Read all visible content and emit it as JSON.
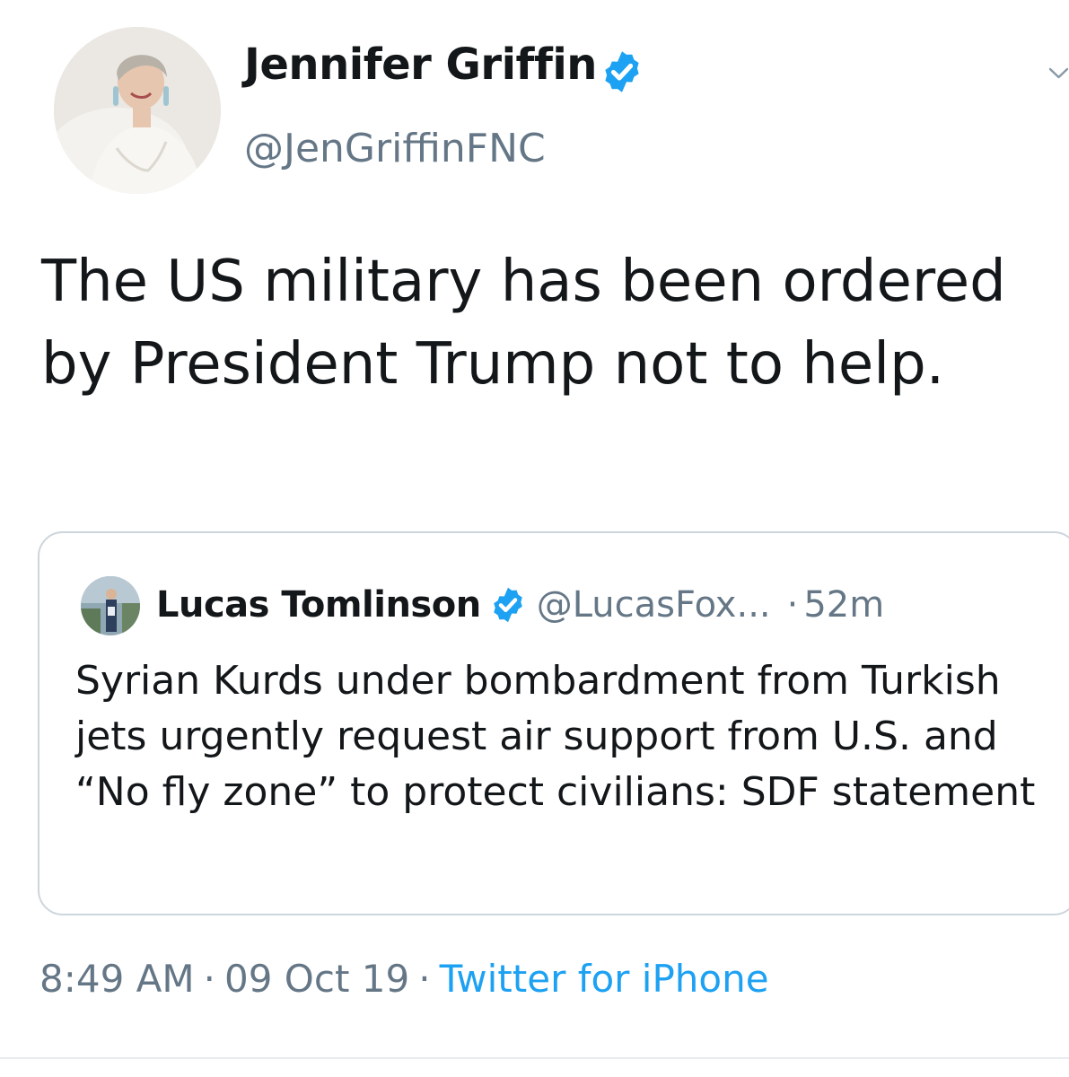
{
  "tweet": {
    "author": {
      "name": "Jennifer Griffin",
      "handle": "@JenGriffinFNC",
      "verified_icon": "verified-badge-icon",
      "avatar": "profile-photo"
    },
    "menu_icon": "chevron-down-icon",
    "text": "The US military has been ordered by President Trump not to help.",
    "quoted_tweet": {
      "author_name": "Lucas Tomlinson",
      "author_handle": "@LucasFox...",
      "separator": "·",
      "time": "52m",
      "verified_icon": "verified-badge-icon",
      "text": "Syrian Kurds under bombardment from Turkish jets urgently request air support from U.S. and “No fly zone” to protect civilians: SDF statement"
    },
    "meta": {
      "time": "8:49 AM",
      "separator": "·",
      "date": "09 Oct 19",
      "source": "Twitter for iPhone"
    }
  },
  "colors": {
    "text": "#14171a",
    "secondary": "#657786",
    "accent": "#1da1f2",
    "border": "#ccd6dd"
  }
}
